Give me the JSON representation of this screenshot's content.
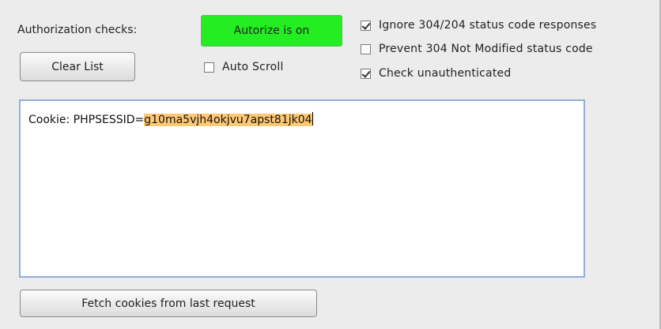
{
  "controls": {
    "authorization_label": "Authorization checks:",
    "autorize_button": "Autorize is on",
    "clear_button": "Clear List",
    "auto_scroll": {
      "label": "Auto Scroll",
      "checked": false
    },
    "fetch_button": "Fetch cookies from last request"
  },
  "options": {
    "ignore_status": {
      "label": "Ignore 304/204 status code responses",
      "checked": true
    },
    "prevent_304": {
      "label": "Prevent 304 Not Modified status code",
      "checked": false
    },
    "check_unauth": {
      "label": "Check unauthenticated",
      "checked": true
    }
  },
  "headers_text": {
    "prefix": "Cookie: PHPSESSID=",
    "selected_value": "g10ma5vjh4okjvu7apst81jk04"
  },
  "colors": {
    "autorize_on": "#22ee22",
    "selection_highlight": "#ffc874",
    "textarea_border": "#8fb0d4"
  }
}
